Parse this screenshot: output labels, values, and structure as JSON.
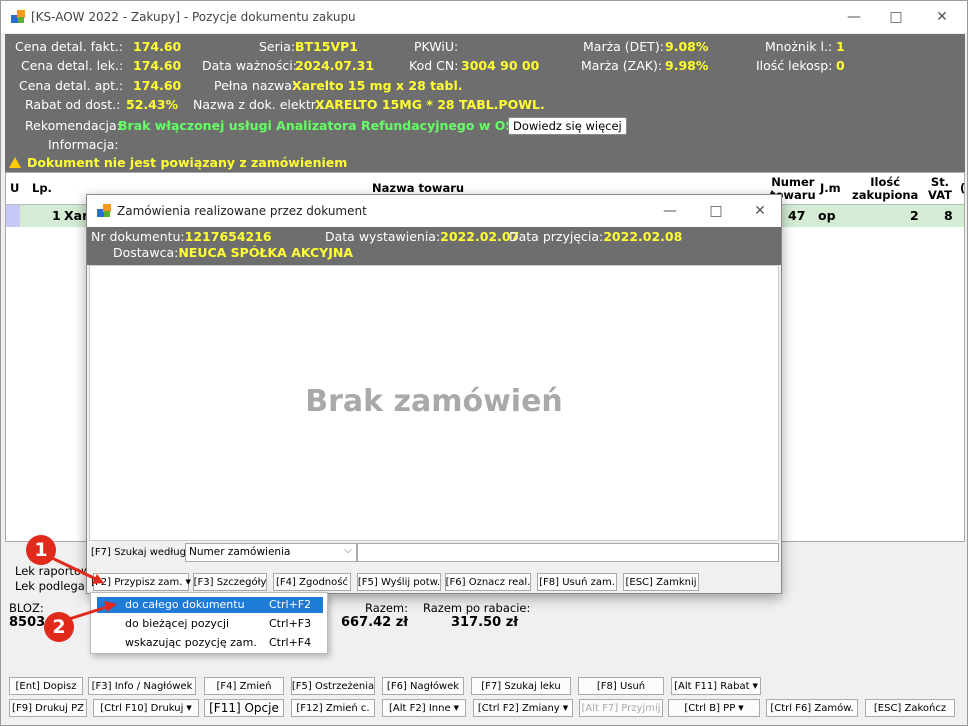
{
  "window": {
    "title": "[KS-AOW 2022 - Zakupy] - Pozycje dokumentu zakupu"
  },
  "header": {
    "cena_det_fakt_label": "Cena detal. fakt.:",
    "cena_det_fakt": "174.60",
    "cena_det_lek_label": "Cena detal. lek.:",
    "cena_det_lek": "174.60",
    "cena_det_apt_label": "Cena detal. apt.:",
    "cena_det_apt": "174.60",
    "rabat_label": "Rabat od dost.:",
    "rabat": "52.43%",
    "seria_label": "Seria:",
    "seria": "BT15VP1",
    "data_waz_label": "Data ważności:",
    "data_waz": "2024.07.31",
    "pelna_label": "Pełna nazwa:",
    "pelna": "Xarelto 15 mg x 28 tabl.",
    "nazwa_elektr_label": "Nazwa z dok. elektr.:",
    "nazwa_elektr": "XARELTO 15MG * 28 TABL.POWL.",
    "pkwiu_label": "PKWiU:",
    "kod_cn_label": "Kod CN:",
    "kod_cn": "3004 90 00",
    "marza_det_label": "Marża (DET):",
    "marza_det": "9.08%",
    "marza_zak_label": "Marża (ZAK):",
    "marza_zak": "9.98%",
    "mnoznik_label": "Mnożnik l.:",
    "mnoznik": "1",
    "ilosc_lekosp_label": "Ilość lekosp:",
    "ilosc_lekosp": "0",
    "rekomendacja_label": "Rekomendacja:",
    "rekomendacja": "Brak włączonej usługi Analizatora Refundacyjnego w OSOZ",
    "more_button": "Dowiedz się więcej",
    "informacja_label": "Informacja:",
    "warning": "Dokument nie jest powiązany z zamówieniem"
  },
  "grid": {
    "headers": {
      "u": "U",
      "lp": "Lp.",
      "nazwa": "Nazwa towaru",
      "numer1": "Numer",
      "numer2": "towaru",
      "jm": "J.m",
      "ilosc1": "Ilość",
      "ilosc2": "zakupiona",
      "st1": "St.",
      "st2": "VAT",
      "extra": "("
    },
    "row": {
      "lp": "1",
      "nazwa": "Xare",
      "numer": "47",
      "jm": "op",
      "ilosc": "2",
      "vat": "8"
    }
  },
  "status": {
    "lek_raportow": "Lek raportow",
    "lek_podlega": "Lek podlega se"
  },
  "totals": {
    "bloz_label": "BLOZ:",
    "bloz": "8503",
    "razem_label": "Razem:",
    "razem": "667.42 zł",
    "razem_rabat_label": "Razem po rabacie:",
    "razem_rabat": "317.50 zł"
  },
  "fbar1": [
    "[Ent] Dopisz",
    "[F3] Info / Nagłówek",
    "[F4] Zmień",
    "[F5] Ostrzeżenia",
    "[F6] Nagłówek",
    "[F7] Szukaj leku",
    "[F8] Usuń",
    "[Alt F11] Rabat"
  ],
  "fbar2": [
    "[F9] Drukuj PZ",
    "[Ctrl F10] Drukuj",
    "[F11] Opcje",
    "[F12] Zmień c.",
    "[Alt F2] Inne",
    "[Ctrl F2] Zmiany",
    "[Alt F7] Przyjmij",
    "[Ctrl B] PP",
    "[Ctrl F6] Zamów.",
    "[ESC] Zakończ"
  ],
  "dialog": {
    "title": "Zamówienia realizowane przez dokument",
    "nr_label": "Nr dokumentu:",
    "nr": "1217654216",
    "data_wyst_label": "Data wystawienia:",
    "data_wyst": "2022.02.07",
    "data_przyj_label": "Data przyjęcia:",
    "data_przyj": "2022.02.08",
    "dostawca_label": "Dostawca:",
    "dostawca": "NEUCA SPÓŁKA AKCYJNA",
    "empty": "Brak zamówień",
    "search_label": "[F7] Szukaj według:",
    "search_value": "Numer zamówienia",
    "buttons": [
      "[F2] Przypisz zam.",
      "[F3] Szczegóły",
      "[F4] Zgodność",
      "[F5] Wyślij potw.",
      "[F6] Oznacz real.",
      "[F8] Usuń zam.",
      "[ESC] Zamknij"
    ]
  },
  "menu": {
    "items": [
      {
        "label": "do całego dokumentu",
        "shortcut": "Ctrl+F2"
      },
      {
        "label": "do bieżącej pozycji",
        "shortcut": "Ctrl+F3"
      },
      {
        "label": "wskazując pozycję zam.",
        "shortcut": "Ctrl+F4"
      }
    ]
  },
  "callouts": [
    "1",
    "2"
  ]
}
